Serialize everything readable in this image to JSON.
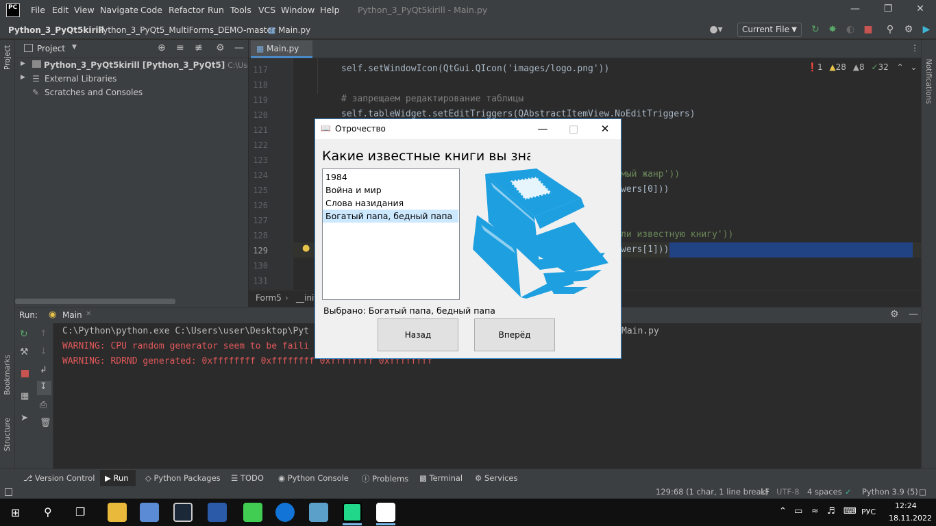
{
  "menubar": {
    "items": [
      "File",
      "Edit",
      "View",
      "Navigate",
      "Code",
      "Refactor",
      "Run",
      "Tools",
      "VCS",
      "Window",
      "Help"
    ],
    "window_title": "Python_3_PyQt5kirill - Main.py"
  },
  "navbar": {
    "crumbs": [
      "Python_3_PyQt5kirill",
      "Python_3_PyQt5_MultiForms_DEMO-master",
      "Main.py"
    ],
    "run_config": "Current File"
  },
  "left_strip": {
    "project_label": "Project",
    "bookmarks_label": "Bookmarks",
    "structure_label": "Structure"
  },
  "right_strip": {
    "notifications_label": "Notifications"
  },
  "project": {
    "title": "Project",
    "tree": [
      {
        "name": "Python_3_PyQt5kirill [Python_3_PyQt5]",
        "path": "C:\\Users\\user\\D"
      },
      {
        "name": "External Libraries",
        "path": ""
      },
      {
        "name": "Scratches and Consoles",
        "path": ""
      }
    ]
  },
  "editor": {
    "tab": "Main.py",
    "inspections": {
      "errors": "1",
      "warnings": "28",
      "weak": "8",
      "typos": "32"
    },
    "line_numbers": [
      "117",
      "118",
      "119",
      "120",
      "121",
      "122",
      "123",
      "124",
      "125",
      "126",
      "127",
      "128",
      "129",
      "130",
      "131"
    ],
    "lines": {
      "l117": "self.setWindowIcon(QtGui.QIcon('images/logo.png'))",
      "l119": "# запрещаем редактирование таблицы",
      "l120": "self.tableWidget.setEditTriggers(QAbstractItemView.NoEditTriggers)",
      "l124": "мый жанр'))",
      "l125": "wers[0]))",
      "l128": "ли известную книгу'))",
      "l129": "wers[1]))"
    },
    "breadcrumb": [
      "Form5",
      "__init"
    ]
  },
  "run": {
    "label": "Run:",
    "tab": "Main",
    "output": [
      {
        "text": "C:\\Python\\python.exe C:\\Users\\user\\Desktop\\Pyt",
        "tail": "Main.py",
        "kind": "cmd"
      },
      {
        "text": "WARNING: CPU random generator seem to be faili",
        "kind": "warn"
      },
      {
        "text": "WARNING: RDRND generated: 0xffffffff 0xffffffff 0xffffffff 0xffffffff",
        "kind": "warn"
      }
    ]
  },
  "bottom_tabs": [
    "Version Control",
    "Run",
    "Python Packages",
    "TODO",
    "Python Console",
    "Problems",
    "Terminal",
    "Services"
  ],
  "status": {
    "position": "129:68 (1 char, 1 line break)",
    "line_sep": "LF",
    "encoding": "UTF-8",
    "indent": "4 spaces",
    "interpreter": "Python 3.9 (5)"
  },
  "taskbar": {
    "lang": "РУС",
    "time": "12:24",
    "date": "18.11.2022"
  },
  "dialog": {
    "title": "Отрочество",
    "heading": "Какие известные книги вы знаете?",
    "books": [
      "1984",
      "Война и мир",
      "Слова назидания",
      "Богатый папа, бедный папа"
    ],
    "selected_index": 3,
    "selected_text": "Выбрано: Богатый папа, бедный папа",
    "back_label": "Назад",
    "next_label": "Вперёд"
  },
  "colors": {
    "accent": "#4a88c7",
    "warning": "#e0585a",
    "book_blue": "#1e9fe0",
    "selection": "#214283"
  }
}
